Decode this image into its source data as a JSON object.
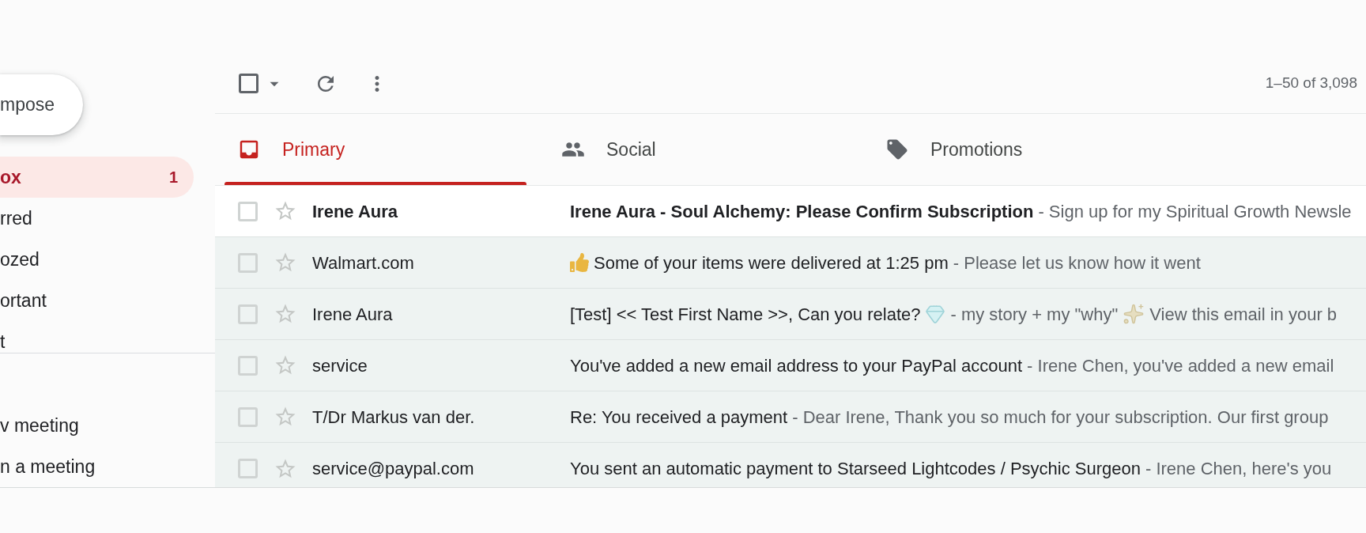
{
  "compose": {
    "label": "mpose"
  },
  "sidebar": {
    "items": [
      {
        "label": "ox",
        "count": "1",
        "selected": true
      },
      {
        "label": "rred",
        "selected": false
      },
      {
        "label": "ozed",
        "selected": false
      },
      {
        "label": "ortant",
        "selected": false
      },
      {
        "label": "t",
        "selected": false
      }
    ],
    "meet_items": [
      {
        "label": "v meeting"
      },
      {
        "label": "n a meeting"
      }
    ]
  },
  "toolbar": {
    "select_all": {
      "checked": false
    },
    "range": "1–50 of 3,098"
  },
  "tabs": [
    {
      "label": "Primary",
      "selected": true
    },
    {
      "label": "Social",
      "selected": false
    },
    {
      "label": "Promotions",
      "selected": false
    }
  ],
  "emails": [
    {
      "sender": "Irene Aura",
      "unread": true,
      "checked": false,
      "starred": false,
      "subject": [
        {
          "kind": "text",
          "text": "Irene Aura - Soul Alchemy: Please Confirm Subscription"
        }
      ],
      "snippet": [
        {
          "kind": "text",
          "text": "- Sign up for my Spiritual Growth Newsle"
        }
      ]
    },
    {
      "sender": "Walmart.com",
      "unread": false,
      "checked": false,
      "starred": false,
      "subject": [
        {
          "kind": "thumbs_up"
        },
        {
          "kind": "text",
          "text": "Some of your items were delivered at 1:25 pm"
        }
      ],
      "snippet": [
        {
          "kind": "text",
          "text": "- Please let us know how it went"
        }
      ]
    },
    {
      "sender": "Irene Aura",
      "unread": false,
      "checked": false,
      "starred": false,
      "subject": [
        {
          "kind": "text",
          "text": "[Test] << Test First Name >>, Can you relate?"
        },
        {
          "kind": "gem"
        }
      ],
      "snippet": [
        {
          "kind": "text",
          "text": "- my story + my \"why\""
        },
        {
          "kind": "sparkles"
        },
        {
          "kind": "text",
          "text": "View this email in your b"
        }
      ]
    },
    {
      "sender": "service",
      "unread": false,
      "checked": false,
      "starred": false,
      "subject": [
        {
          "kind": "text",
          "text": "You've added a new email address to your PayPal account"
        }
      ],
      "snippet": [
        {
          "kind": "text",
          "text": "- Irene Chen, you've added a new email"
        }
      ]
    },
    {
      "sender": "T/Dr Markus van der.",
      "unread": false,
      "checked": false,
      "starred": false,
      "subject": [
        {
          "kind": "text",
          "text": "Re: You received a payment"
        }
      ],
      "snippet": [
        {
          "kind": "text",
          "text": "- Dear Irene, Thank you so much for your subscription. Our first group"
        }
      ]
    },
    {
      "sender": "service@paypal.com",
      "unread": false,
      "checked": false,
      "starred": false,
      "subject": [
        {
          "kind": "text",
          "text": "You sent an automatic payment to Starseed Lightcodes / Psychic Surgeon"
        }
      ],
      "snippet": [
        {
          "kind": "text",
          "text": "- Irene Chen, here's you"
        }
      ]
    }
  ]
}
